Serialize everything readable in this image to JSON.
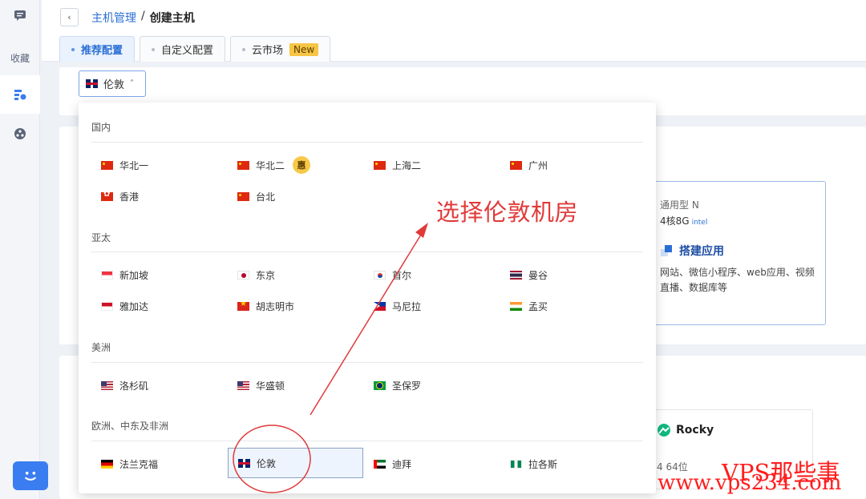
{
  "rail": {
    "favorites_label": "收藏"
  },
  "breadcrumb": {
    "parent": "主机管理",
    "separator": "/",
    "current": "创建主机"
  },
  "tabs": [
    {
      "label": "推荐配置",
      "active": true
    },
    {
      "label": "自定义配置",
      "active": false
    },
    {
      "label": "云市场",
      "active": false,
      "badge": "New"
    }
  ],
  "region_select": {
    "value": "伦敦"
  },
  "bg_card": {
    "type_label": "通用型 N",
    "spec": "4核8G",
    "cpu_brand": "intel",
    "title": "搭建应用",
    "desc": "网站、微信小程序、web应用、视频直播、数据库等"
  },
  "rocky_card": {
    "name": "Rocky",
    "sub": "4 64位"
  },
  "dropdown": {
    "groups": [
      {
        "title": "国内",
        "options": [
          {
            "label": "华北一",
            "flag": "cn"
          },
          {
            "label": "华北二",
            "flag": "cn",
            "badge": "惠"
          },
          {
            "label": "上海二",
            "flag": "cn"
          },
          {
            "label": "广州",
            "flag": "cn"
          },
          {
            "label": "香港",
            "flag": "hk"
          },
          {
            "label": "台北",
            "flag": "cn"
          }
        ]
      },
      {
        "title": "亚太",
        "options": [
          {
            "label": "新加坡",
            "flag": "sg"
          },
          {
            "label": "东京",
            "flag": "jp"
          },
          {
            "label": "首尔",
            "flag": "kr"
          },
          {
            "label": "曼谷",
            "flag": "th"
          },
          {
            "label": "雅加达",
            "flag": "id"
          },
          {
            "label": "胡志明市",
            "flag": "vn"
          },
          {
            "label": "马尼拉",
            "flag": "ph"
          },
          {
            "label": "孟买",
            "flag": "in"
          }
        ]
      },
      {
        "title": "美洲",
        "options": [
          {
            "label": "洛杉矶",
            "flag": "us"
          },
          {
            "label": "华盛顿",
            "flag": "us"
          },
          {
            "label": "圣保罗",
            "flag": "br"
          }
        ]
      },
      {
        "title": "欧洲、中东及非洲",
        "options": [
          {
            "label": "法兰克福",
            "flag": "de"
          },
          {
            "label": "伦敦",
            "flag": "uk",
            "selected": true
          },
          {
            "label": "迪拜",
            "flag": "ae"
          },
          {
            "label": "拉各斯",
            "flag": "ng"
          }
        ]
      }
    ]
  },
  "annotation": {
    "text": "选择伦敦机房",
    "color": "#e03a3a"
  },
  "watermark": {
    "name": "VPS那些事",
    "url": "www.vps234.com"
  },
  "colors": {
    "accent": "#2a6fd6",
    "badge_new": "#f6c544",
    "annotation_red": "#e03a3a"
  }
}
